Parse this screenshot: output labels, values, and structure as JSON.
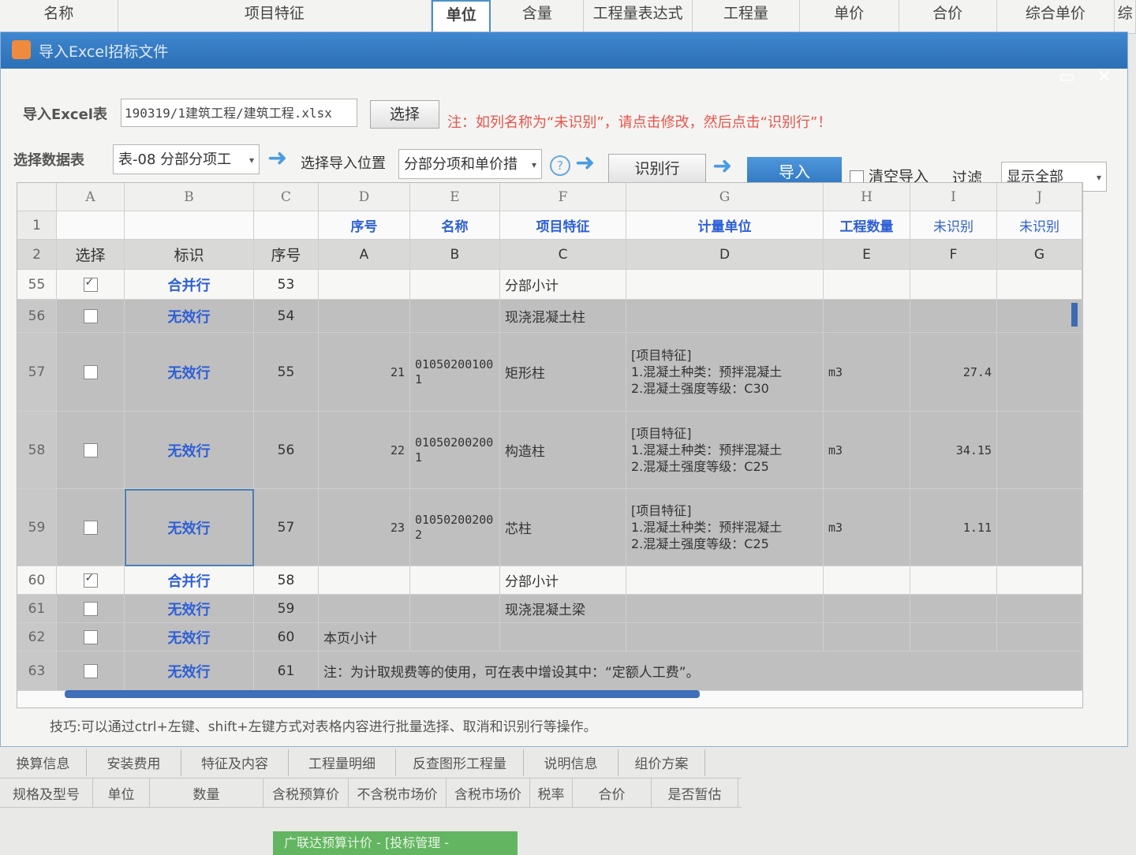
{
  "bg_header": {
    "columns": [
      "名称",
      "项目特征",
      "单位",
      "含量",
      "工程量表达式",
      "工程量",
      "单价",
      "合价",
      "综合单价",
      "综"
    ]
  },
  "dialog": {
    "title": "导入Excel招标文件",
    "import_label": "导入Excel表",
    "file_path": "190319/1建筑工程/建筑工程.xlsx",
    "choose_button": "选择",
    "note": "注：如列名称为“未识别”，请点击修改，然后点击“识别行”！",
    "select_table_label": "选择数据表",
    "table_select": "表-08 分部分项工",
    "select_position_label": "选择导入位置",
    "position_select": "分部分项和单价措",
    "identify_button": "识别行",
    "import_button": "导入",
    "clear_import_label": "清空导入",
    "filter_label": "过滤",
    "filter_select": "显示全部",
    "tip": "技巧:可以通过ctrl+左键、shift+左键方式对表格内容进行批量选择、取消和识别行等操作。"
  },
  "grid": {
    "col_letters": [
      "A",
      "B",
      "C",
      "D",
      "E",
      "F",
      "G",
      "H",
      "I",
      "J"
    ],
    "row1": {
      "num": "1",
      "D": "序号",
      "E": "名称",
      "F": "项目特征",
      "G": "计量单位",
      "H": "工程数量",
      "I": "未识别",
      "J": "未识别"
    },
    "row2": {
      "num": "2",
      "A": "选择",
      "B": "标识",
      "C": "序号",
      "D": "A",
      "E": "B",
      "F": "C",
      "G": "D",
      "H": "E",
      "I": "F",
      "J": "G"
    },
    "rows": [
      {
        "num": "55",
        "checked": true,
        "tag": "合并行",
        "seq": "53",
        "d": "",
        "code1": "",
        "code2": "",
        "name": "分部小计",
        "feat_title": "",
        "feat_1": "",
        "feat_2": "",
        "unit": "",
        "qty": ""
      },
      {
        "num": "56",
        "checked": false,
        "tag": "无效行",
        "seq": "54",
        "d": "",
        "code1": "",
        "code2": "",
        "name": "现浇混凝土柱",
        "feat_title": "",
        "feat_1": "",
        "feat_2": "",
        "unit": "",
        "qty": ""
      },
      {
        "num": "57",
        "checked": false,
        "tag": "无效行",
        "seq": "55",
        "d": "21",
        "code1": "01050200100",
        "code2": "1",
        "name": "矩形柱",
        "feat_title": "[项目特征]",
        "feat_1": "1.混凝土种类：预拌混凝土",
        "feat_2": "2.混凝土强度等级：C30",
        "unit": "m3",
        "qty": "27.4"
      },
      {
        "num": "58",
        "checked": false,
        "tag": "无效行",
        "seq": "56",
        "d": "22",
        "code1": "01050200200",
        "code2": "1",
        "name": "构造柱",
        "feat_title": "[项目特征]",
        "feat_1": "1.混凝土种类：预拌混凝土",
        "feat_2": "2.混凝土强度等级：C25",
        "unit": "m3",
        "qty": "34.15"
      },
      {
        "num": "59",
        "checked": false,
        "tag": "无效行",
        "seq": "57",
        "d": "23",
        "code1": "01050200200",
        "code2": "2",
        "name": "芯柱",
        "feat_title": "[项目特征]",
        "feat_1": "1.混凝土种类：预拌混凝土",
        "feat_2": "2.混凝土强度等级：C25",
        "unit": "m3",
        "qty": "1.11"
      },
      {
        "num": "60",
        "checked": true,
        "tag": "合并行",
        "seq": "58",
        "d": "",
        "code1": "",
        "code2": "",
        "name": "分部小计",
        "feat_title": "",
        "feat_1": "",
        "feat_2": "",
        "unit": "",
        "qty": ""
      },
      {
        "num": "61",
        "checked": false,
        "tag": "无效行",
        "seq": "59",
        "d": "",
        "code1": "",
        "code2": "",
        "name": "现浇混凝土梁",
        "feat_title": "",
        "feat_1": "",
        "feat_2": "",
        "unit": "",
        "qty": ""
      },
      {
        "num": "62",
        "checked": false,
        "tag": "无效行",
        "seq": "60",
        "d": "本页小计",
        "code1": "",
        "code2": "",
        "name": "",
        "feat_title": "",
        "feat_1": "",
        "feat_2": "",
        "unit": "",
        "qty": ""
      },
      {
        "num": "63",
        "checked": false,
        "tag": "无效行",
        "seq": "61",
        "d": "注：为计取规费等的使用，可在表中增设其中：“定额人工费”。",
        "code1": "",
        "code2": "",
        "name": "",
        "feat_title": "",
        "feat_1": "",
        "feat_2": "",
        "unit": "",
        "qty": ""
      }
    ]
  },
  "bottom_tabs": [
    "换算信息",
    "安装费用",
    "特征及内容",
    "工程量明细",
    "反查图形工程量",
    "说明信息",
    "组价方案"
  ],
  "bottom_cols": [
    "规格及型号",
    "单位",
    "数量",
    "含税预算价",
    "不含税市场价",
    "含税市场价",
    "税率",
    "合价",
    "是否暂估"
  ],
  "taskbar_text": "广联达预算计价 - [投标管理 -"
}
